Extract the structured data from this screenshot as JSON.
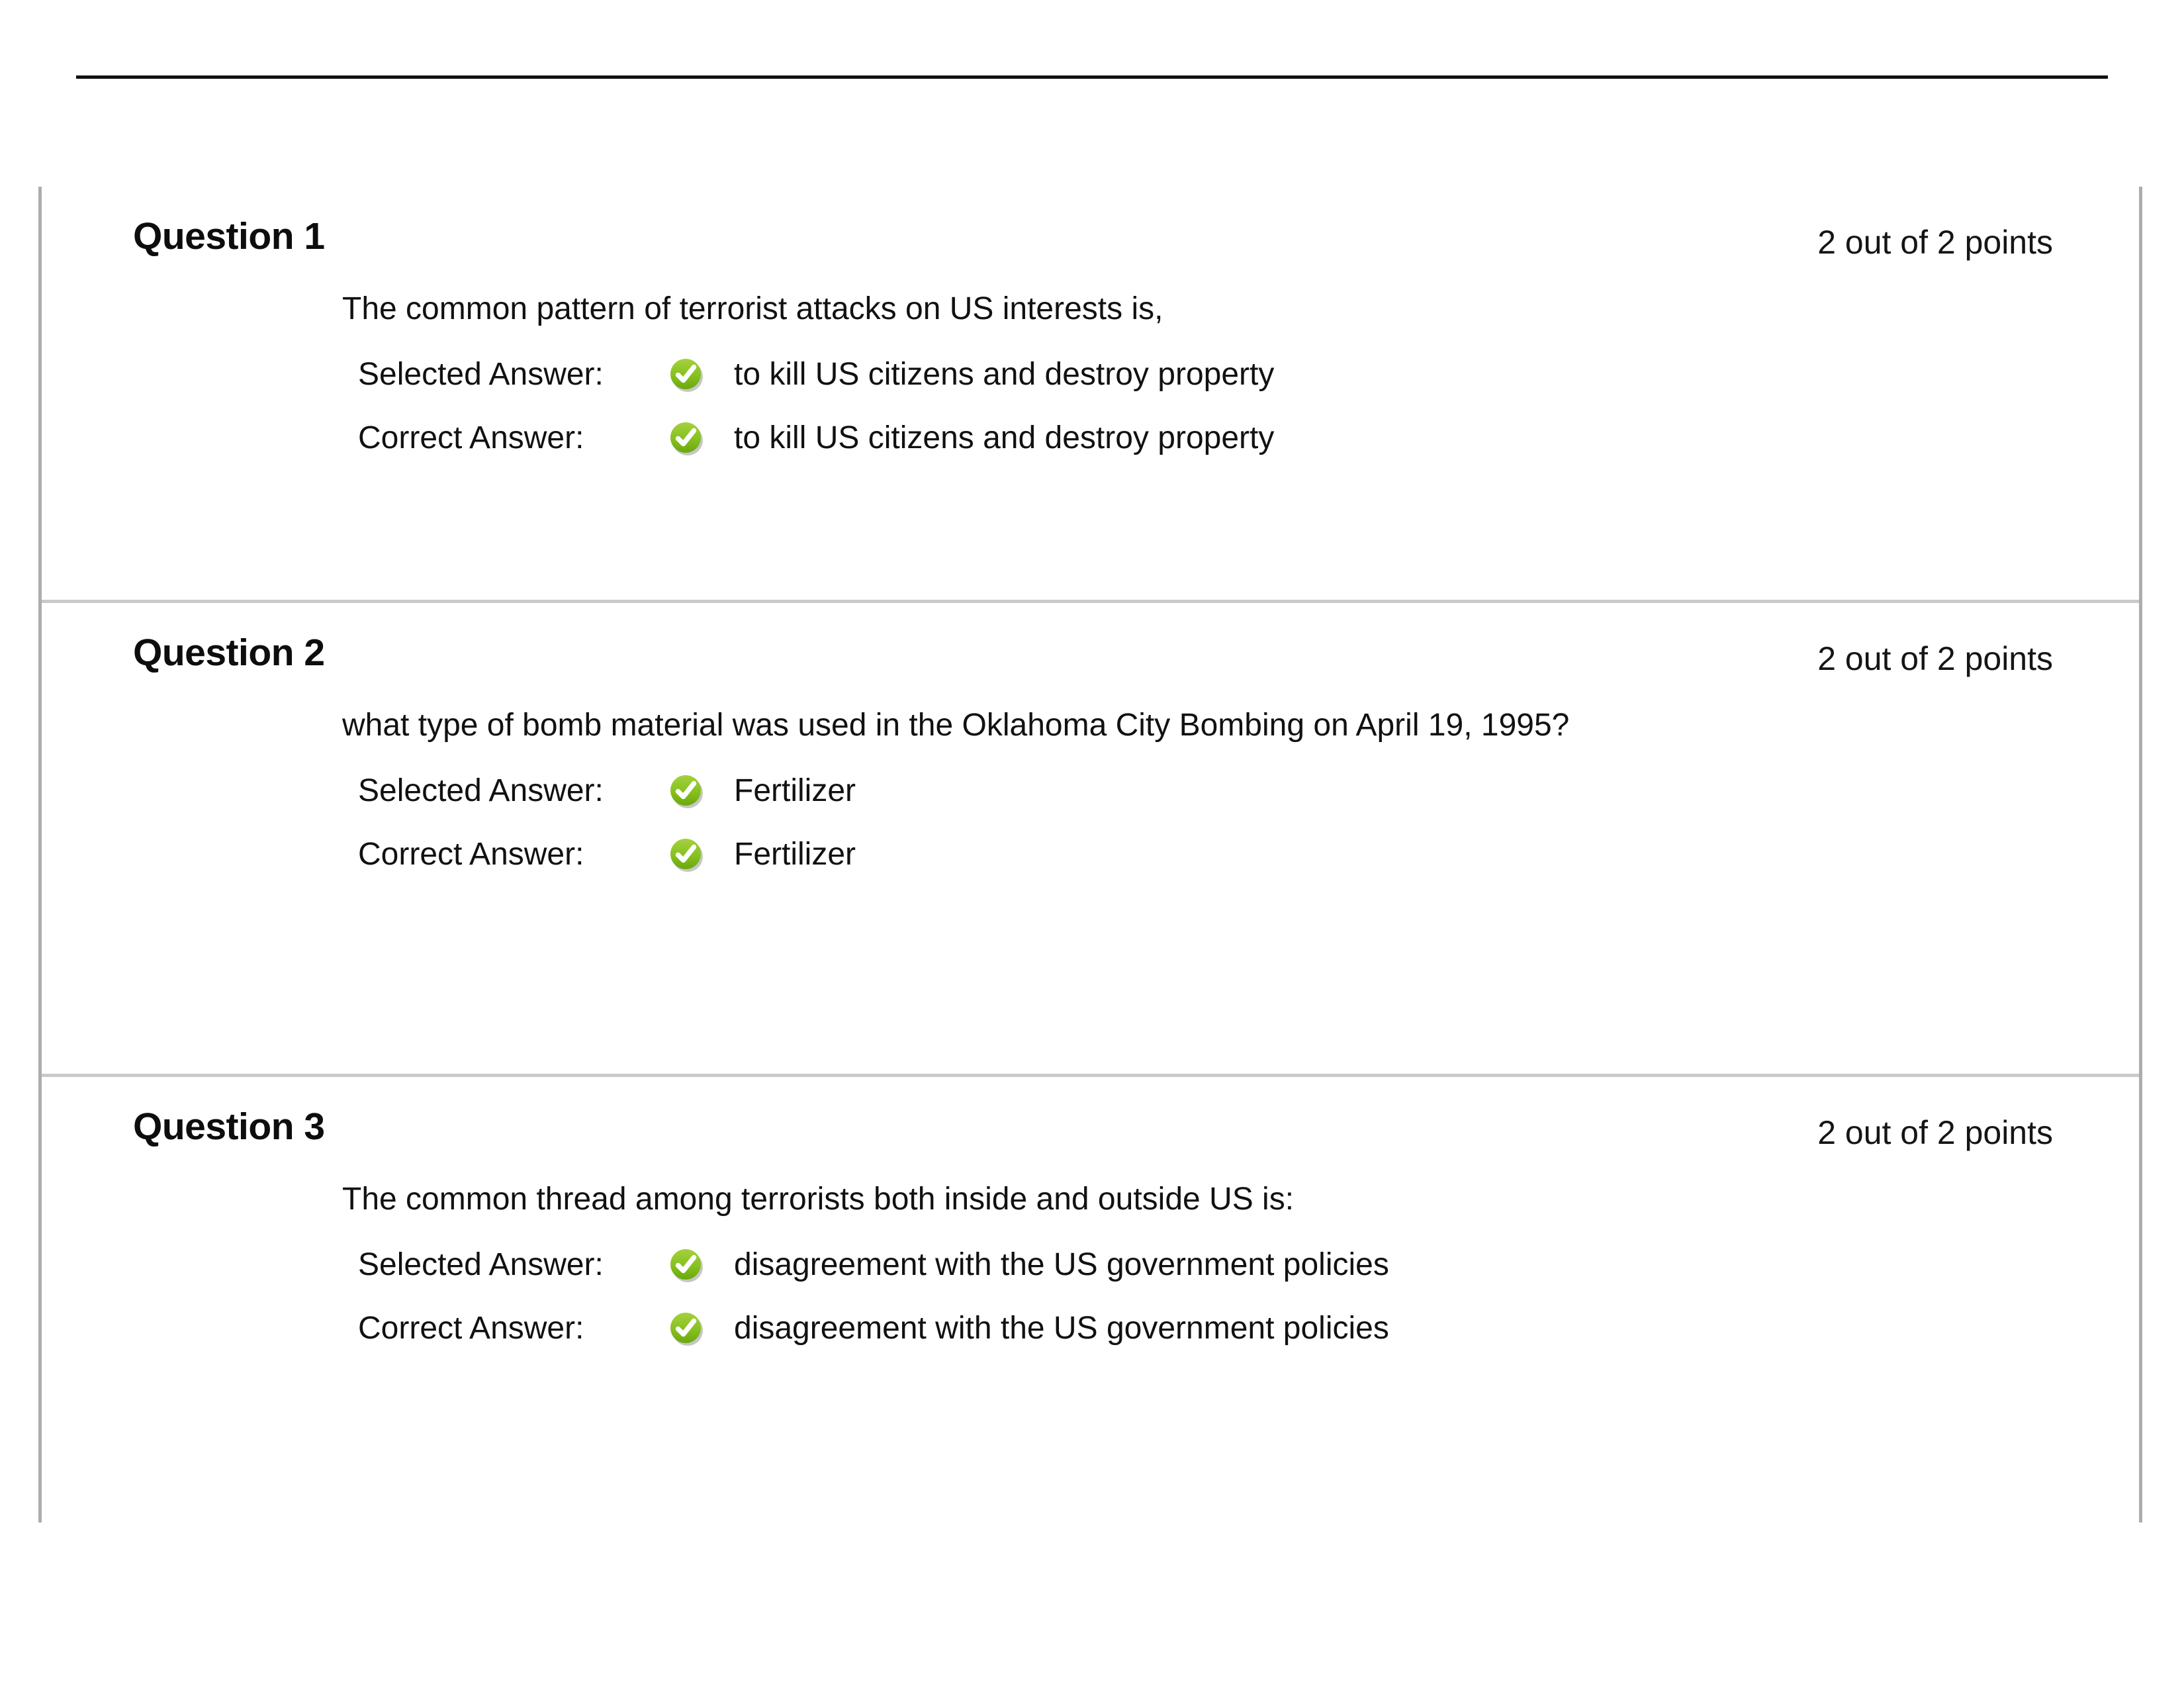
{
  "page": {
    "background_color": "#ffffff",
    "rule_color": "#111111",
    "container_border_color": "#adadad",
    "separator_color": "#cacaca"
  },
  "icons": {
    "correct_check": {
      "name": "green-check-icon",
      "fill_light": "#9ccb3b",
      "fill_dark": "#76b51a",
      "check_color": "#ffffff"
    }
  },
  "labels": {
    "selected_answer": "Selected Answer:",
    "correct_answer": "Correct Answer:"
  },
  "questions": [
    {
      "title": "Question 1",
      "points": "2 out of 2 points",
      "text": "The common pattern of terrorist attacks on US interests is,",
      "selected_answer": "to kill US citizens and destroy property",
      "correct_answer": "to kill US citizens and destroy property",
      "selected_status": "correct",
      "correct_status": "correct"
    },
    {
      "title": "Question 2",
      "points": "2 out of 2 points",
      "text": "what type of bomb material was used in the Oklahoma City Bombing on April 19, 1995?",
      "selected_answer": "Fertilizer",
      "correct_answer": "Fertilizer",
      "selected_status": "correct",
      "correct_status": "correct"
    },
    {
      "title": "Question 3",
      "points": "2 out of 2 points",
      "text": "The common thread among terrorists both inside and outside US is:",
      "selected_answer": "disagreement with the US government policies",
      "correct_answer": "disagreement with the US government policies",
      "selected_status": "correct",
      "correct_status": "correct"
    }
  ]
}
